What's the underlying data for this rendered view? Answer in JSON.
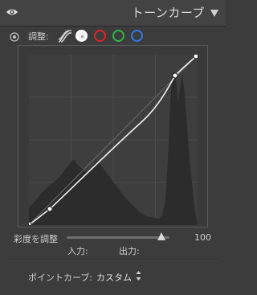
{
  "header": {
    "title": "トーンカーブ"
  },
  "toolbar": {
    "adjust_label": "調整:",
    "channels": [
      "rgb",
      "red",
      "green",
      "blue"
    ],
    "selected_channel": "rgb"
  },
  "saturation": {
    "label": "彩度を調整",
    "value": "100"
  },
  "io": {
    "input_label": "入力:",
    "output_label": "出力:"
  },
  "point_curve": {
    "label": "ポイントカーブ:",
    "value": "カスタム"
  },
  "colors": {
    "red": "#e0242b",
    "green": "#2fb64a",
    "blue": "#2f78e0"
  },
  "icons": [
    "eye-icon",
    "collapse-triangle-icon",
    "target-adjustment-icon",
    "parametric-curve-icon",
    "up-down-arrows-icon"
  ]
}
